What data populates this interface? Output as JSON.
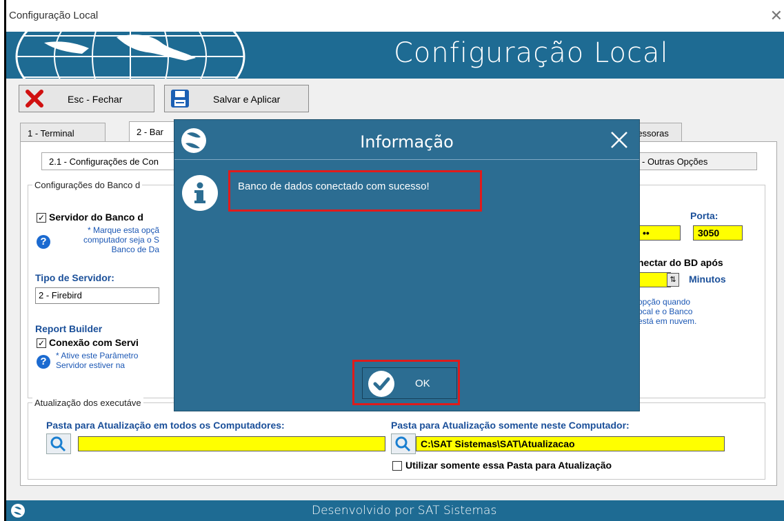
{
  "window": {
    "title": "Configuração Local",
    "close_glyph": "✕"
  },
  "banner": {
    "title": "Configuração Local"
  },
  "toolbar": {
    "close_label": "Esc - Fechar",
    "save_label": "Salvar e Aplicar"
  },
  "tabs": [
    {
      "label": "1 - Terminal"
    },
    {
      "label": "2 - Bar"
    },
    {
      "label": "ressoras"
    }
  ],
  "subtabs": [
    {
      "label": "2.1 - Configurações de Con"
    },
    {
      "label": "- Outras Opções"
    }
  ],
  "db_group": {
    "title": "Configurações do Banco d",
    "server_checkbox_label": "Servidor do Banco d",
    "server_checked": true,
    "server_note": "* Marque esta opçã\ncomputador seja o S\nBanco de Da",
    "server_type_label": "Tipo de Servidor:",
    "server_type_value": "2 - Firebird",
    "report_builder_label": "Report Builder",
    "rb_checkbox_label": "Conexão com Servi",
    "rb_checked": true,
    "rb_note": "* Ative este Parâmetro\nServidor estiver na",
    "port_label": "Porta:",
    "port_value": "3050",
    "password_value": "••",
    "disconnect_label": "nectar do BD após",
    "minutes_label": "Minutos",
    "right_note": "opção quando\nocal e o Banco\nestá em nuvem."
  },
  "update_group": {
    "title": "Atualização dos executáve",
    "all_label": "Pasta para Atualização em todos os Computadores:",
    "all_value": "",
    "this_label": "Pasta para Atualização somente neste Computador:",
    "this_value": "C:\\SAT Sistemas\\SAT\\Atualizacao",
    "only_this_label": "Utilizar somente essa Pasta para Atualização",
    "only_this_checked": false
  },
  "footer": {
    "text": "Desenvolvido por SAT Sistemas"
  },
  "dialog": {
    "title": "Informação",
    "message": "Banco de dados conectado com sucesso!",
    "ok_label": "OK"
  },
  "colors": {
    "brand_blue": "#1e6b93",
    "dialog_blue": "#2c6d92",
    "highlight_red": "#e01b1b",
    "field_yellow": "#ffff00"
  },
  "icons": [
    "globe-icon",
    "close-x-icon",
    "save-disk-icon",
    "search-icon",
    "help-icon",
    "info-icon",
    "check-circle-icon",
    "spin-icon"
  ]
}
